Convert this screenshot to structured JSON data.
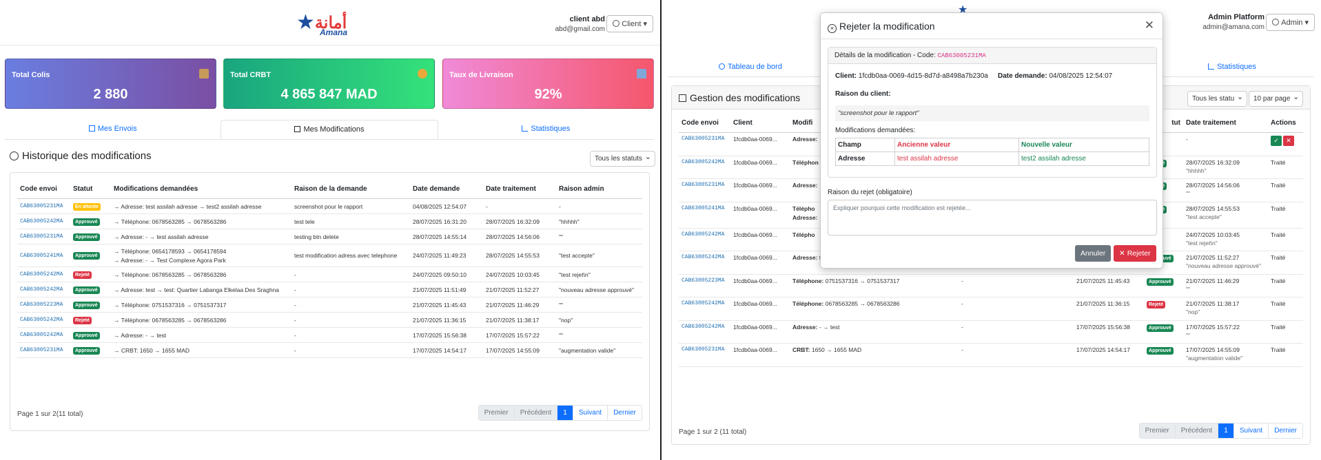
{
  "brand": {
    "arabic": "أمانة",
    "latin": "Amana"
  },
  "left": {
    "user": {
      "name": "client abd",
      "email": "abd@gmail.com",
      "role": "Client"
    },
    "stats": [
      {
        "title": "Total Colis",
        "value": "2 880",
        "color_start": "#6a7ee0",
        "color_end": "#7a4fa3"
      },
      {
        "title": "Total CRBT",
        "value": "4 865 847 MAD",
        "color_start": "#19a57f",
        "color_end": "#34e27a"
      },
      {
        "title": "Taux de Livraison",
        "value": "92%",
        "color_start": "#f08ad8",
        "color_end": "#f5576c"
      }
    ],
    "tabs": [
      "Mes Envois",
      "Mes Modifications",
      "Statistiques"
    ],
    "section_title": "Historique des modifications",
    "filter": "Tous les statuts",
    "columns": [
      "Code envoi",
      "Statut",
      "Modifications demandées",
      "Raison de la demande",
      "Date demande",
      "Date traitement",
      "Raison admin"
    ],
    "rows": [
      {
        "code": "CAB63005231MA",
        "status": "En attente",
        "kind": "att",
        "mods": [
          "→ Adresse: test assilah adresse → test2 assilah adresse"
        ],
        "reason": "screenshot pour le rapport",
        "date": "04/08/2025 12:54:07",
        "treated": "-",
        "admin": "-"
      },
      {
        "code": "CAB63005242MA",
        "status": "Approuvé",
        "kind": "app",
        "mods": [
          "→ Téléphone: 0678563285 → 0678563286"
        ],
        "reason": "test tele",
        "date": "28/07/2025 16:31:20",
        "treated": "28/07/2025 16:32:09",
        "admin": "\"hhhhh\""
      },
      {
        "code": "CAB63005231MA",
        "status": "Approuvé",
        "kind": "app",
        "mods": [
          "→ Adresse: - → test assilah adresse"
        ],
        "reason": "testing btn delete",
        "date": "28/07/2025 14:55:14",
        "treated": "28/07/2025 14:56:06",
        "admin": "\"\""
      },
      {
        "code": "CAB63005241MA",
        "status": "Approuvé",
        "kind": "app",
        "mods": [
          "→ Téléphone: 0654178593 → 0654178594",
          "→ Adresse: - → Test Complexe Agora Park"
        ],
        "reason": "test modification adress avec telephone",
        "date": "24/07/2025 11:49:23",
        "treated": "28/07/2025 14:55:53",
        "admin": "\"test accepte\""
      },
      {
        "code": "CAB63005242MA",
        "status": "Rejeté",
        "kind": "rej",
        "mods": [
          "→ Téléphone: 0678563285 → 0678563286"
        ],
        "reason": "-",
        "date": "24/07/2025 09:50:10",
        "treated": "24/07/2025 10:03:45",
        "admin": "\"test rejet\\n\""
      },
      {
        "code": "CAB63005242MA",
        "status": "Approuvé",
        "kind": "app",
        "mods": [
          "→ Adresse: test → test: Quartier Labanga Elkelaa Des Sraghna"
        ],
        "reason": "-",
        "date": "21/07/2025 11:51:49",
        "treated": "21/07/2025 11:52:27",
        "admin": "\"nouveau adresse approuvé\""
      },
      {
        "code": "CAB63005223MA",
        "status": "Approuvé",
        "kind": "app",
        "mods": [
          "→ Téléphone: 0751537316 → 0751537317"
        ],
        "reason": "-",
        "date": "21/07/2025 11:45:43",
        "treated": "21/07/2025 11:46:29",
        "admin": "\"\""
      },
      {
        "code": "CAB63005242MA",
        "status": "Rejeté",
        "kind": "rej",
        "mods": [
          "→ Téléphone: 0678563285 → 0678563286"
        ],
        "reason": "-",
        "date": "21/07/2025 11:36:15",
        "treated": "21/07/2025 11:38:17",
        "admin": "\"nop\""
      },
      {
        "code": "CAB63005242MA",
        "status": "Approuvé",
        "kind": "app",
        "mods": [
          "→ Adresse: - → test"
        ],
        "reason": "-",
        "date": "17/07/2025 15:56:38",
        "treated": "17/07/2025 15:57:22",
        "admin": "\"\""
      },
      {
        "code": "CAB63005231MA",
        "status": "Approuvé",
        "kind": "app",
        "mods": [
          "→ CRBT: 1650 → 1655 MAD"
        ],
        "reason": "-",
        "date": "17/07/2025 14:54:17",
        "treated": "17/07/2025 14:55:09",
        "admin": "\"augmentation valide\""
      }
    ],
    "page_info": "Page 1 sur 2(11 total)",
    "pagination": [
      "Premier",
      "Précédent",
      "1",
      "Suivant",
      "Dernier"
    ]
  },
  "right": {
    "user": {
      "name": "Admin Platform",
      "email": "admin@amana.com",
      "role": "Admin"
    },
    "tabs": [
      "Tableau de bord",
      "Statistiques"
    ],
    "section_title": "Gestion des modifications",
    "filter": "Tous les statu",
    "per_page": "10 par page",
    "columns": [
      "Code envoi",
      "Client",
      "Modifi",
      "tut",
      "Date traitement",
      "Actions"
    ],
    "rows": [
      {
        "code": "CAB63005231MA",
        "client": "1fcdb0aa-0069...",
        "mod_label": "Adresse:",
        "mod_value": "",
        "reason": "",
        "date": "",
        "status": "Atten",
        "kind": "att",
        "treated": "-",
        "treated_sub": "",
        "action": "buttons"
      },
      {
        "code": "CAB63005242MA",
        "client": "1fcdb0aa-0069...",
        "mod_label": "Téléphon",
        "mod_value": "",
        "reason": "",
        "date": "",
        "status": "prouvé",
        "kind": "app",
        "treated": "28/07/2025 16:32:09",
        "treated_sub": "\"hhhhh\"",
        "action": "Traité"
      },
      {
        "code": "CAB63005231MA",
        "client": "1fcdb0aa-0069...",
        "mod_label": "Adresse:",
        "mod_value": "",
        "reason": "",
        "date": "",
        "status": "prouvé",
        "kind": "app",
        "treated": "28/07/2025 14:56:06",
        "treated_sub": "\"\"",
        "action": "Traité"
      },
      {
        "code": "CAB63005241MA",
        "client": "1fcdb0aa-0069...",
        "mod_label": "Télépho",
        "mod_label2": "Adresse:",
        "mod_value": "",
        "reason": "",
        "date": "",
        "status": "prouvé",
        "kind": "app",
        "treated": "28/07/2025 14:55:53",
        "treated_sub": "\"test accepte\"",
        "action": "Traité"
      },
      {
        "code": "CAB63005242MA",
        "client": "1fcdb0aa-0069...",
        "mod_label": "Télépho",
        "mod_value": "",
        "reason": "",
        "date": "",
        "status": "eté",
        "kind": "rej",
        "treated": "24/07/2025 10:03:45",
        "treated_sub": "\"test rejet\\n\"",
        "action": "Traité"
      },
      {
        "code": "CAB63005242MA",
        "client": "1fcdb0aa-0069...",
        "mod_label": "Adresse:",
        "mod_value": "test → test: Quartier Labanga Elkelaa Des Sraghna",
        "reason": "-",
        "date": "21/07/2025 11:51:49",
        "status": "Approuvé",
        "kind": "app",
        "treated": "21/07/2025 11:52:27",
        "treated_sub": "\"nouveau adresse approuvé\"",
        "action": "Traité"
      },
      {
        "code": "CAB63005223MA",
        "client": "1fcdb0aa-0069...",
        "mod_label": "Téléphone:",
        "mod_value": "0751537316 → 0751537317",
        "reason": "-",
        "date": "21/07/2025 11:45:43",
        "status": "Approuvé",
        "kind": "app",
        "treated": "21/07/2025 11:46:29",
        "treated_sub": "\"\"",
        "action": "Traité"
      },
      {
        "code": "CAB63005242MA",
        "client": "1fcdb0aa-0069...",
        "mod_label": "Téléphone:",
        "mod_value": "0678563285 → 0678563286",
        "reason": "-",
        "date": "21/07/2025 11:36:15",
        "status": "Rejeté",
        "kind": "rej",
        "treated": "21/07/2025 11:38:17",
        "treated_sub": "\"nop\"",
        "action": "Traité"
      },
      {
        "code": "CAB63005242MA",
        "client": "1fcdb0aa-0069...",
        "mod_label": "Adresse:",
        "mod_value": "- → test",
        "reason": "-",
        "date": "17/07/2025 15:56:38",
        "status": "Approuvé",
        "kind": "app",
        "treated": "17/07/2025 15:57:22",
        "treated_sub": "\"\"",
        "action": "Traité"
      },
      {
        "code": "CAB63005231MA",
        "client": "1fcdb0aa-0069...",
        "mod_label": "CRBT:",
        "mod_value": "1650 → 1655 MAD",
        "reason": "-",
        "date": "17/07/2025 14:54:17",
        "status": "Approuvé",
        "kind": "app",
        "treated": "17/07/2025 14:55:09",
        "treated_sub": "\"augmentation valide\"",
        "action": "Traité"
      }
    ],
    "page_info": "Page 1 sur 2 (11 total)",
    "pagination": [
      "Premier",
      "Précédent",
      "1",
      "Suivant",
      "Dernier"
    ]
  },
  "modal": {
    "title": "Rejeter la modification",
    "details_header": "Détails de la modification - Code:",
    "details_code": "CAB63005231MA",
    "client_label": "Client:",
    "client_value": "1fcdb0aa-0069-4d15-8d7d-a8498a7b230a",
    "date_label": "Date demande:",
    "date_value": "04/08/2025 12:54:07",
    "reason_label": "Raison du client:",
    "reason_value": "\"screenshot pour le rapport\"",
    "mods_label": "Modifications demandées:",
    "mods_cols": [
      "Champ",
      "Ancienne valeur",
      "Nouvelle valeur"
    ],
    "mods_rows": [
      {
        "field": "Adresse",
        "old": "test assilah adresse",
        "new": "test2 assilah adresse"
      }
    ],
    "reject_label": "Raison du rejet (obligatoire)",
    "reject_placeholder": "Expliquer pourquoi cette modification est rejetée...",
    "cancel": "Annuler",
    "reject": "Rejeter"
  },
  "colors": {
    "primary": "#0d6efd",
    "success": "#198754",
    "danger": "#dc3545",
    "warning": "#ffc107",
    "secondary": "#6c757d"
  }
}
